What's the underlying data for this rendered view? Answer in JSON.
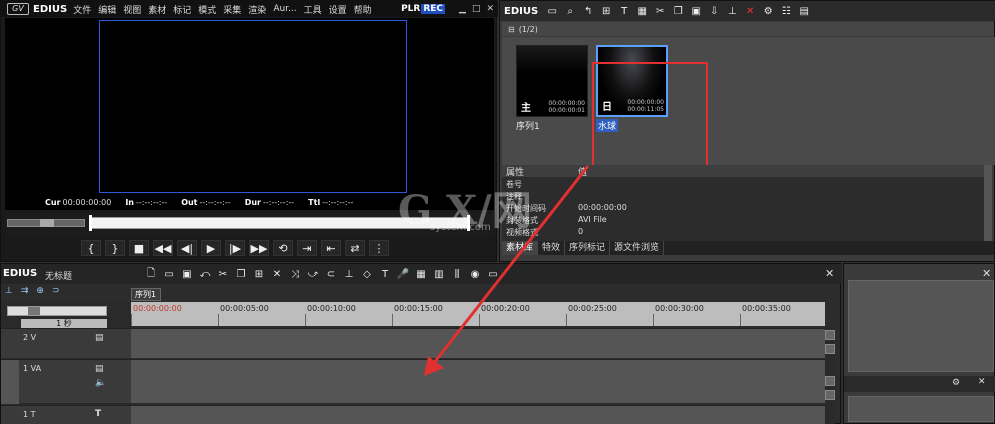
{
  "player": {
    "brand": "EDIUS",
    "menu": [
      "文件",
      "编辑",
      "视图",
      "素材",
      "标记",
      "模式",
      "采集",
      "渲染",
      "Aur...",
      "工具",
      "设置",
      "帮助"
    ],
    "plr": "PLR",
    "rec": "REC",
    "timecodes": [
      {
        "label": "Cur",
        "value": "00:00:00:00"
      },
      {
        "label": "In",
        "value": "--:--:--:--"
      },
      {
        "label": "Out",
        "value": "--:--:--:--"
      },
      {
        "label": "Dur",
        "value": "--:--:--:--"
      },
      {
        "label": "Ttl",
        "value": "--:--:--:--"
      }
    ]
  },
  "bin": {
    "brand": "EDIUS",
    "folder_label": "(1/2)",
    "clips": [
      {
        "name": "序列1",
        "type": "主",
        "tc1": "00:00:00:00",
        "tc2": "00:00:00:01"
      },
      {
        "name": "水球",
        "type": "日",
        "tc1": "00:00:00:00",
        "tc2": "00:00:11:05"
      }
    ],
    "props_header": {
      "col1": "属性",
      "col2": "值"
    },
    "props": [
      {
        "k": "卷号",
        "v": ""
      },
      {
        "k": "注释",
        "v": ""
      },
      {
        "k": "开始时间码",
        "v": "00:00:00:00"
      },
      {
        "k": "封装格式",
        "v": "AVI File"
      },
      {
        "k": "视频格式",
        "v": "0"
      }
    ],
    "tabs": [
      "素材库",
      "特效",
      "序列标记",
      "源文件浏览"
    ]
  },
  "watermark": {
    "main": "G X/网",
    "sub": "system.com"
  },
  "timeline": {
    "brand": "EDIUS",
    "title": "无标题",
    "seq_tab": "序列1",
    "scale": "1 秒",
    "ruler": [
      "00:00:00:00",
      "00:00:05:00",
      "00:00:10:00",
      "00:00:15:00",
      "00:00:20:00",
      "00:00:25:00",
      "00:00:30:00",
      "00:00:35:00"
    ],
    "tracks": [
      {
        "name": "2 V"
      },
      {
        "name": "1 VA"
      },
      {
        "name": "1 T"
      }
    ]
  },
  "colors": {
    "annotation": "#e03030",
    "selection": "#2f5fbf",
    "safe_frame": "#2a58d8"
  }
}
